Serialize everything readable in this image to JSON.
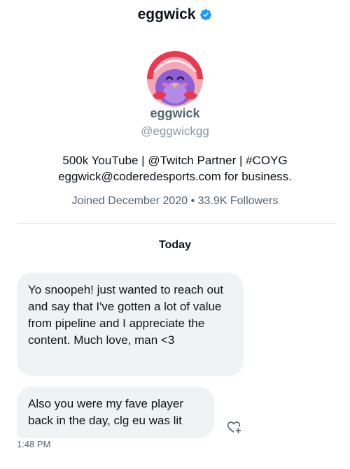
{
  "header": {
    "title": "eggwick",
    "verified_icon": "verified-badge-icon",
    "verified_color": "#1d9bf0"
  },
  "profile": {
    "avatar_icon": "avatar-purple-bird",
    "name": "eggwick",
    "handle": "@eggwickgg",
    "bio_line1": "500k YouTube | @Twitch Partner | #COYG",
    "bio_line2": "eggwick@coderedesports.com for business.",
    "meta": "Joined December 2020 • 33.9K Followers"
  },
  "conversation": {
    "day_label": "Today",
    "messages": [
      {
        "text": "Yo snoopeh! just wanted to reach out and say that I've gotten a lot of value from pipeline and I appreciate the content. Much love, man <3"
      },
      {
        "text": "Also you were my fave player back in the day, clg eu was lit"
      }
    ],
    "react_icon": "heart-plus-icon",
    "timestamp": "1:48 PM"
  }
}
